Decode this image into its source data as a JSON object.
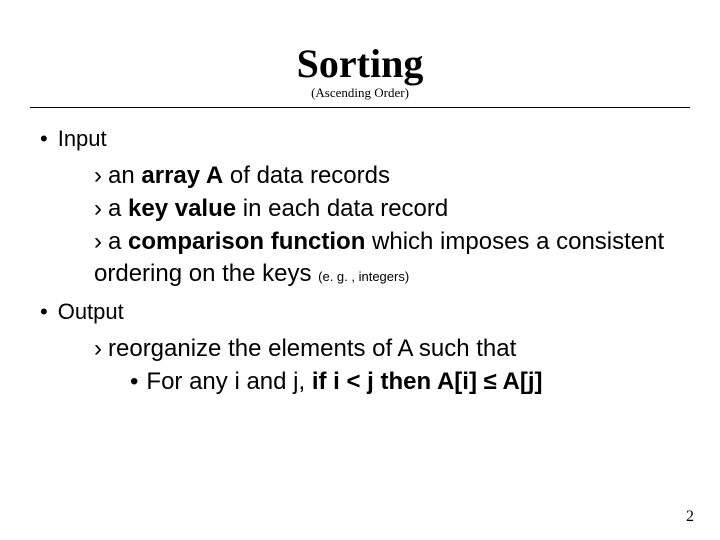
{
  "title": "Sorting",
  "subtitle": "(Ascending Order)",
  "sections": {
    "input": {
      "label": "Input",
      "items": [
        {
          "prefix": "an ",
          "strong": "array A",
          "suffix": " of data records"
        },
        {
          "prefix": "a ",
          "strong": "key value",
          "suffix": " in each data record"
        },
        {
          "prefix": "a ",
          "strong": "comparison function",
          "suffix": " which imposes a consistent ordering on the keys ",
          "note": "(e. g. , integers)"
        }
      ]
    },
    "output": {
      "label": "Output",
      "lead": "reorganize the elements of A such that",
      "condition_prefix": "For any i and j, ",
      "condition_strong": "if i < j then A[i] ≤ A[j]"
    }
  },
  "page_number": "2"
}
